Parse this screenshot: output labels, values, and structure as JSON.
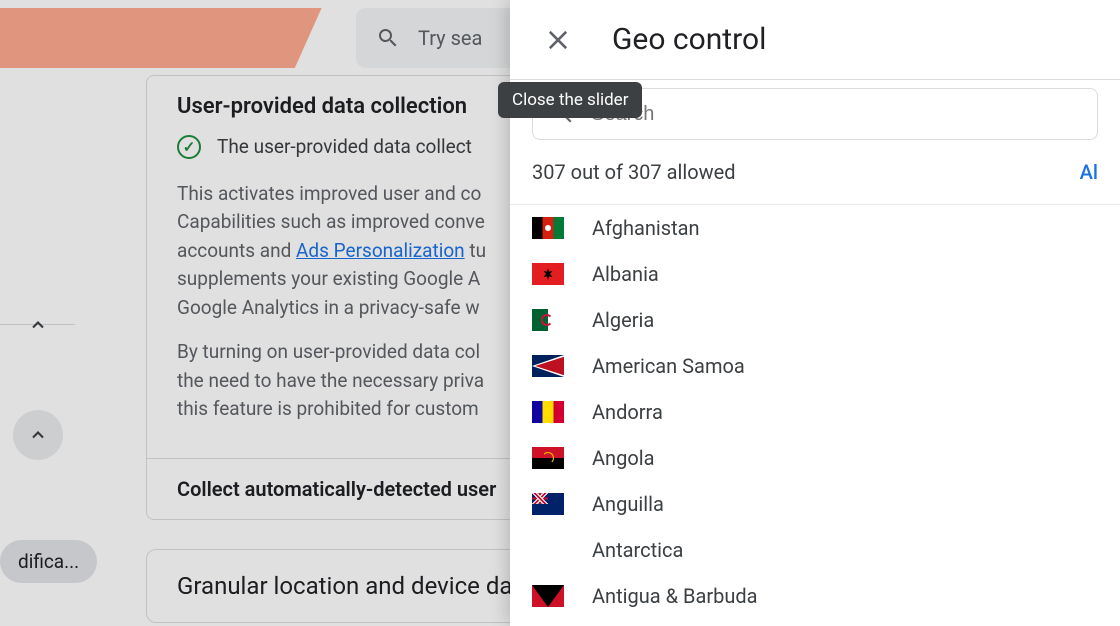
{
  "top_search": {
    "placeholder": "Try sea"
  },
  "left": {
    "pill": "difica..."
  },
  "card": {
    "heading": "User-provided data collection",
    "ack_text": "The user-provided data collect",
    "para1_a": "This activates improved user and co",
    "para1_b": "Capabilities such as improved conve",
    "para1_c": "accounts and ",
    "link": "Ads Personalization",
    "para1_d": " tu",
    "para1_e": "supplements your existing Google A",
    "para1_f": "Google Analytics in a privacy-safe w",
    "para2_a": "By turning on user-provided data col",
    "para2_b": "the need to have the necessary priva",
    "para2_c": "this feature is prohibited for custom",
    "row2": "Collect automatically-detected user"
  },
  "card2": {
    "heading": "Granular location and device da"
  },
  "slider": {
    "title": "Geo control",
    "tooltip": "Close the slider",
    "search_placeholder": "Search",
    "count_text": "307 out of 307 allowed",
    "action": "Al",
    "countries": [
      {
        "name": "Afghanistan",
        "code": "af"
      },
      {
        "name": "Albania",
        "code": "al"
      },
      {
        "name": "Algeria",
        "code": "dz"
      },
      {
        "name": "American Samoa",
        "code": "as"
      },
      {
        "name": "Andorra",
        "code": "ad"
      },
      {
        "name": "Angola",
        "code": "ao"
      },
      {
        "name": "Anguilla",
        "code": "ai"
      },
      {
        "name": "Antarctica",
        "code": "aq"
      },
      {
        "name": "Antigua & Barbuda",
        "code": "ag"
      }
    ]
  }
}
